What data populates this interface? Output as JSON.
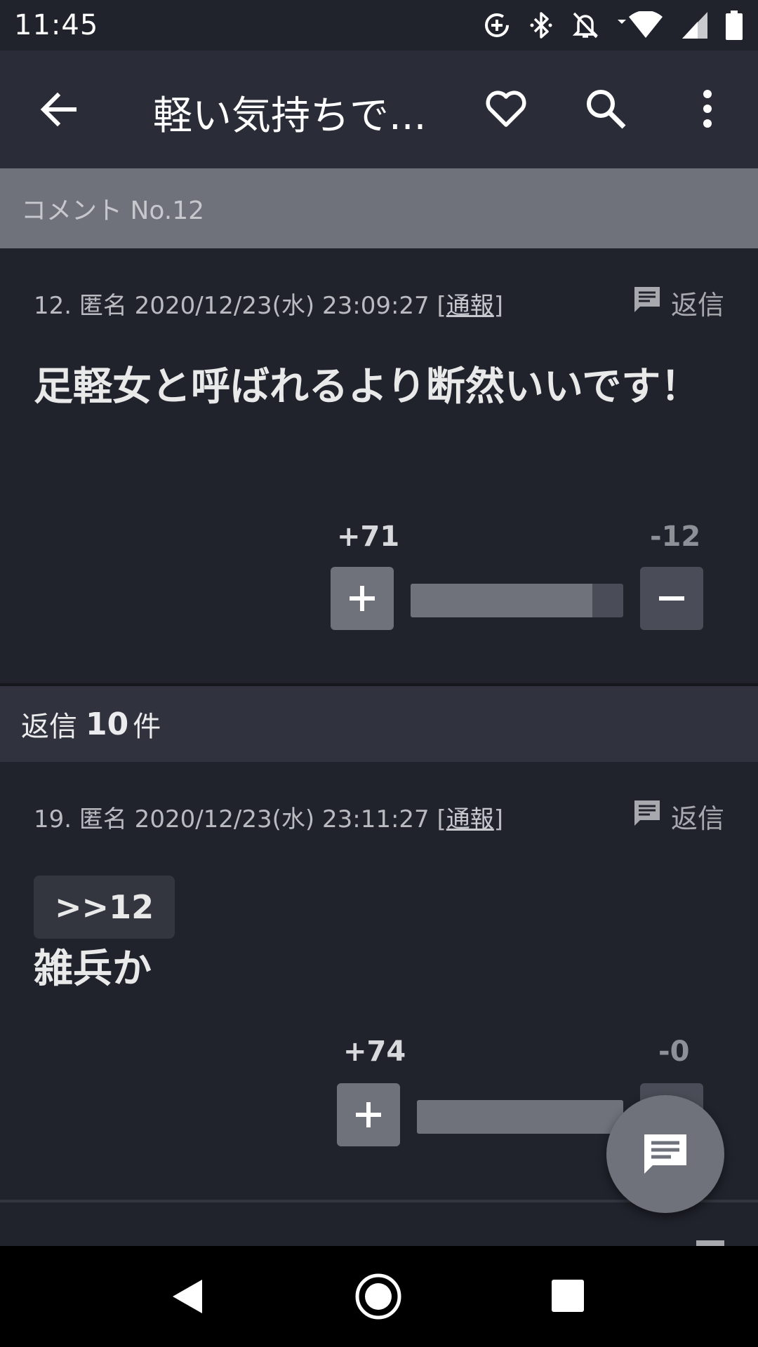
{
  "status_bar": {
    "time": "11:45",
    "icons": [
      "data-saver-icon",
      "bluetooth-icon",
      "notifications-off-icon",
      "wifi-icon",
      "signal-icon",
      "battery-icon"
    ]
  },
  "app_bar": {
    "title": "軽い気持ちで...",
    "icons": [
      "back-arrow-icon",
      "heart-outline-icon",
      "search-icon",
      "more-vert-icon"
    ]
  },
  "section_header": {
    "label": "コメント No.12"
  },
  "comments": [
    {
      "meta_prefix": "12. 匿名 2020/12/23(水) 23:09:27 [",
      "report_label": "通報",
      "meta_suffix": "]",
      "reply_label": "返信",
      "body": "足軽女と呼ばれるより断然いいです！",
      "plus_count": "+71",
      "minus_count": "-12",
      "plus_fraction": 0.855
    },
    {
      "meta_prefix": "19. 匿名 2020/12/23(水) 23:11:27 [",
      "report_label": "通報",
      "meta_suffix": "]",
      "reply_label": "返信",
      "anchor": ">>12",
      "body": "雑兵か",
      "plus_count": "+74",
      "minus_count": "-0",
      "plus_fraction": 1.0
    }
  ],
  "replies_header": {
    "prefix": "返信",
    "count": "10",
    "suffix": "件"
  },
  "colors": {
    "background": "#20232c",
    "app_bar": "#2a2d37",
    "accent_gray": "#6f727b",
    "text": "#e9e9ea"
  }
}
